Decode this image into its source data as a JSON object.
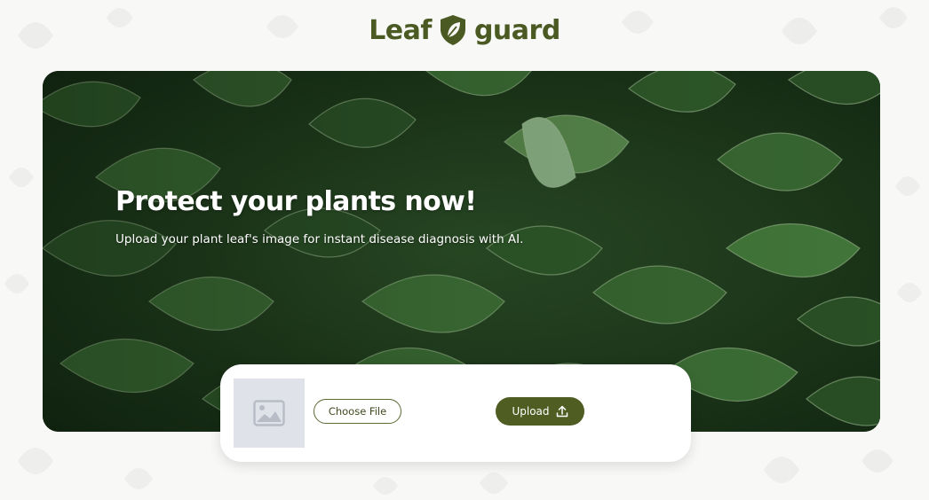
{
  "brand": {
    "name_part1": "Leaf",
    "name_part2": "guard",
    "color": "#4a5a22"
  },
  "hero": {
    "title": "Protect your plants now!",
    "subtitle": "Upload your plant leaf's image for instant disease diagnosis with AI."
  },
  "upload": {
    "choose_label": "Choose File",
    "upload_label": "Upload",
    "preview_icon": "image-placeholder-icon",
    "upload_icon": "upload-icon",
    "accent": "#4f5d23"
  }
}
